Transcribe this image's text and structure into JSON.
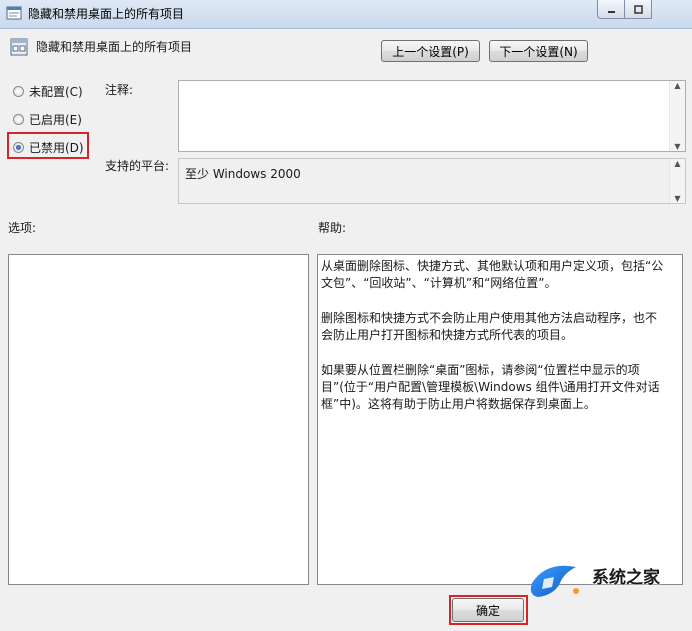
{
  "window": {
    "title": "隐藏和禁用桌面上的所有项目"
  },
  "header": {
    "policy_name": "隐藏和禁用桌面上的所有项目",
    "prev_button": "上一个设置(P)",
    "next_button": "下一个设置(N)"
  },
  "state": {
    "options": [
      {
        "label": "未配置(C)",
        "checked": false
      },
      {
        "label": "已启用(E)",
        "checked": false
      },
      {
        "label": "已禁用(D)",
        "checked": true
      }
    ]
  },
  "comment": {
    "label": "注释:",
    "value": ""
  },
  "platform": {
    "label": "支持的平台:",
    "value": "至少 Windows 2000"
  },
  "options_panel": {
    "label": "选项:"
  },
  "help": {
    "label": "帮助:",
    "paragraphs": [
      "从桌面删除图标、快捷方式、其他默认项和用户定义项，包括“公文包”、“回收站”、“计算机”和“网络位置”。",
      "删除图标和快捷方式不会防止用户使用其他方法启动程序，也不会防止用户打开图标和快捷方式所代表的项目。",
      "如果要从位置栏删除“桌面”图标，请参阅“位置栏中显示的项目”(位于“用户配置\\管理模板\\Windows 组件\\通用打开文件对话框”中)。这将有助于防止用户将数据保存到桌面上。"
    ]
  },
  "footer": {
    "ok_button": "确定"
  },
  "watermark": {
    "text": "系统之家"
  },
  "colors": {
    "highlight_border": "#d8232a",
    "titlebar": "#c9d9ec"
  }
}
